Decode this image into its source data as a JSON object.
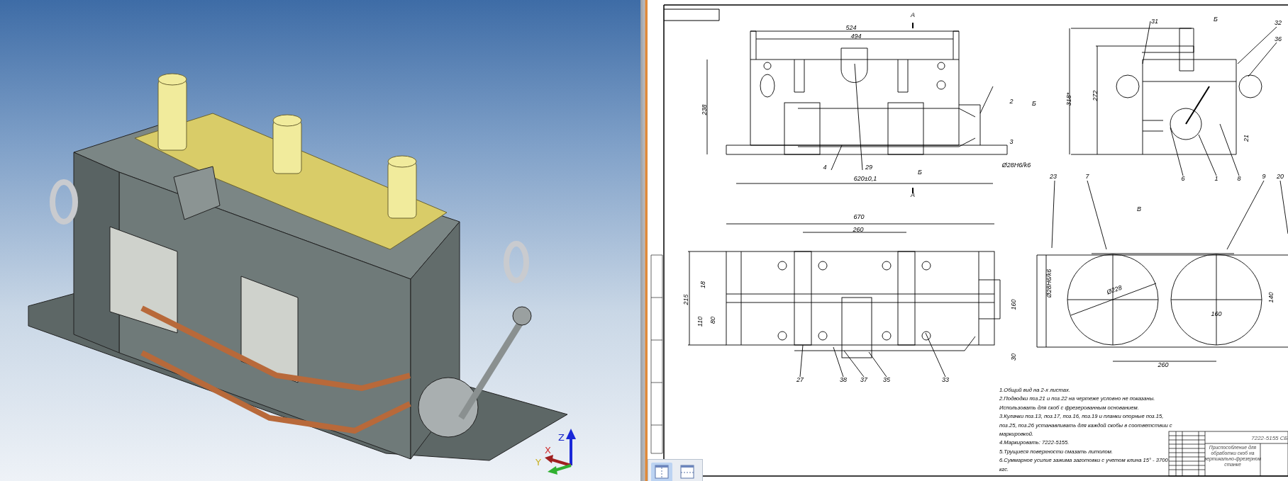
{
  "model_view": {
    "axes": [
      {
        "kind": "z",
        "label": "Z"
      },
      {
        "kind": "x",
        "label": "X"
      },
      {
        "kind": "y",
        "label": "Y"
      }
    ]
  },
  "drawing": {
    "views": [
      {
        "kind": "front",
        "labels": [
          "524",
          "494",
          "238",
          "4",
          "29",
          "620±0,1",
          "А",
          "А",
          "Б",
          "2",
          "Б",
          "3",
          "Ø28H6/k6"
        ]
      },
      {
        "kind": "side",
        "labels": [
          "Б",
          "31",
          "32",
          "36",
          "318*",
          "272",
          "6",
          "1",
          "8",
          "21"
        ]
      },
      {
        "kind": "plan",
        "labels": [
          "670",
          "260",
          "215",
          "18",
          "110",
          "80",
          "160",
          "30",
          "27",
          "38",
          "37",
          "35",
          "33"
        ]
      },
      {
        "kind": "section",
        "labels": [
          "В",
          "23",
          "7",
          "9",
          "20",
          "Ø228",
          "Ø28H6/k6",
          "140",
          "160",
          "260"
        ]
      }
    ],
    "notes": [
      "1.Общий вид на 2-х листах.",
      "2.Подводки поз.21 и поз.22 на чертеже условно не показаны.",
      "Использовать для скоб с фрезерованным основанием.",
      "3.Кулачки поз.13, поз.17, поз.16, поз.19 и планки опорные поз.15,",
      "поз.25, поз.26 устанавливать для каждой скобы в соответствии с",
      "маркировкой.",
      "4.Маркировать: 7222-5155.",
      "5.Трущиеся поверхности смазать литолом.",
      "6.Суммарное усилие зажима заготовки с учетом клина 15° - 3700",
      "кгс."
    ],
    "title_block": {
      "designation": "7222-5155 СБ",
      "name": [
        "Приспособление для",
        "обработки скоб на",
        "вертикально-фрезерном",
        "станке"
      ]
    },
    "sheet_tabs": [
      {
        "selected": true
      },
      {
        "selected": false
      }
    ]
  }
}
